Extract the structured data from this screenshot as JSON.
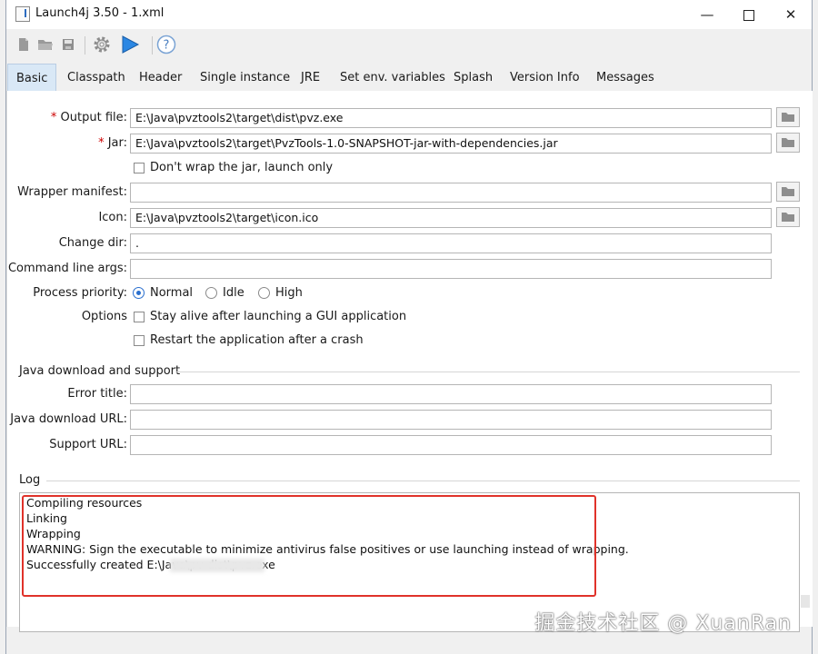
{
  "window": {
    "title": "Launch4j 3.50 - 1.xml",
    "controls": {
      "minimize": "—",
      "maximize": "",
      "close": "✕"
    }
  },
  "toolbar": {
    "buttons": [
      {
        "name": "new",
        "icon": "new-file-icon"
      },
      {
        "name": "open",
        "icon": "folder-open-icon"
      },
      {
        "name": "save",
        "icon": "save-icon"
      },
      {
        "name": "build",
        "icon": "gear-icon"
      },
      {
        "name": "run",
        "icon": "play-icon"
      },
      {
        "name": "help",
        "icon": "help-icon"
      }
    ]
  },
  "tabs": [
    {
      "label": "Basic",
      "active": true
    },
    {
      "label": "Classpath"
    },
    {
      "label": "Header"
    },
    {
      "label": "Single instance"
    },
    {
      "label": "JRE"
    },
    {
      "label": "Set env. variables"
    },
    {
      "label": "Splash"
    },
    {
      "label": "Version Info"
    },
    {
      "label": "Messages"
    }
  ],
  "basic": {
    "output_file": {
      "required": "*",
      "label": "Output file:",
      "value": "E:\\Java\\pvztools2\\target\\dist\\pvz.exe"
    },
    "jar": {
      "required": "*",
      "label": "Jar:",
      "value": "E:\\Java\\pvztools2\\target\\PvzTools-1.0-SNAPSHOT-jar-with-dependencies.jar"
    },
    "dont_wrap": {
      "label": "Don't wrap the jar, launch only",
      "checked": false
    },
    "wrapper_manifest": {
      "label": "Wrapper manifest:",
      "value": ""
    },
    "icon": {
      "label": "Icon:",
      "value": "E:\\Java\\pvztools2\\target\\icon.ico"
    },
    "change_dir": {
      "label": "Change dir:",
      "value": "."
    },
    "cmd_args": {
      "label": "Command line args:",
      "value": ""
    },
    "priority": {
      "label": "Process priority:",
      "options": [
        "Normal",
        "Idle",
        "High"
      ],
      "selected": "Normal"
    },
    "options": {
      "label": "Options",
      "stay_alive": {
        "label": "Stay alive after launching a GUI application",
        "checked": false
      },
      "restart": {
        "label": "Restart the application after a crash",
        "checked": false
      }
    }
  },
  "java_download": {
    "section_title": "Java download and support",
    "error_title": {
      "label": "Error title:",
      "value": ""
    },
    "download_url": {
      "label": "Java download URL:",
      "value": ""
    },
    "support_url": {
      "label": "Support URL:",
      "value": ""
    }
  },
  "log": {
    "section_title": "Log",
    "lines": [
      "Compiling resources",
      "Linking",
      "Wrapping",
      "WARNING: Sign the executable to minimize antivirus false positives or use launching instead of wrapping.",
      "Successfully created E:\\Java\\pv                   dist\\pvz.exe"
    ]
  },
  "watermark": "掘金技术社区 @ XuanRan",
  "colors": {
    "accent": "#2a6fce",
    "highlight_frame": "#e0322a",
    "active_tab": "#d9e8f6"
  }
}
